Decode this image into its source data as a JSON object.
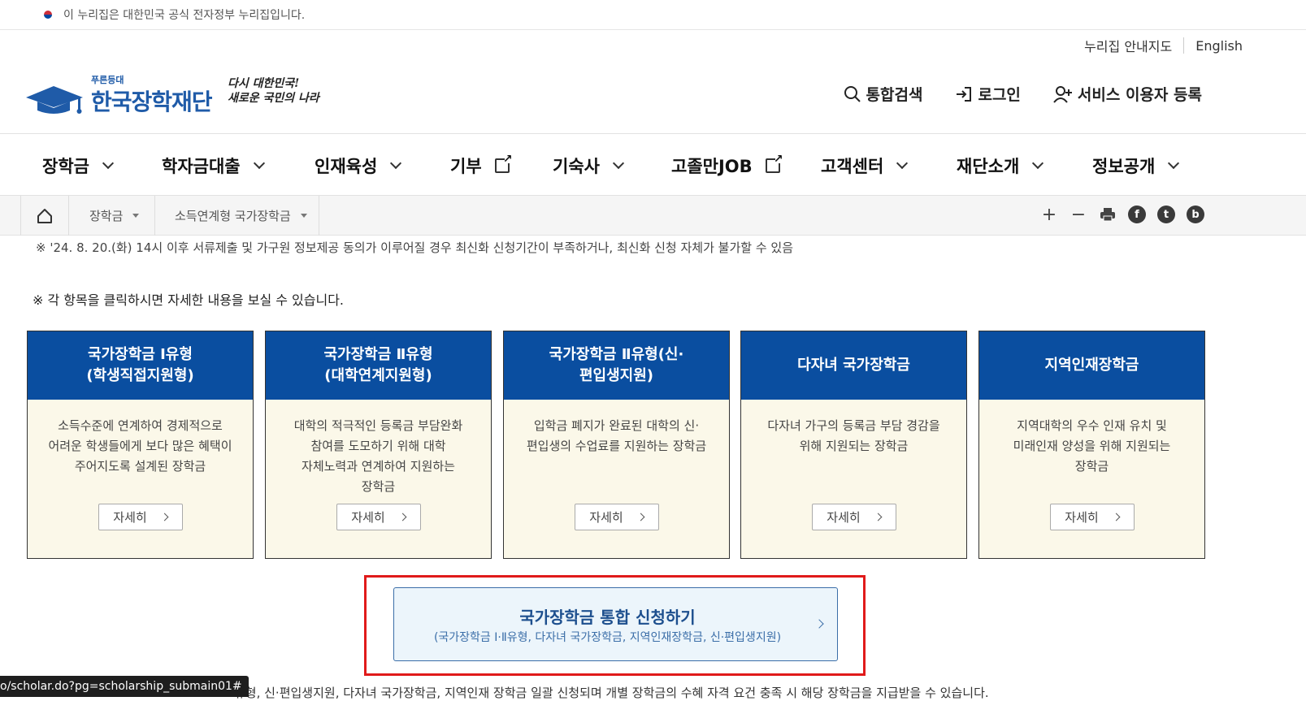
{
  "gov_bar": {
    "text": "이 누리집은 대한민국 공식 전자정부 누리집입니다."
  },
  "util": {
    "sitemap": "누리집 안내지도",
    "english": "English"
  },
  "logo": {
    "small": "푸른등대",
    "big": "한국장학재단",
    "slogan_line1": "다시 대한민국!",
    "slogan_line2": "새로운 국민의 나라"
  },
  "header_links": {
    "search": "통합검색",
    "login": "로그인",
    "register": "서비스 이용자 등록"
  },
  "gnb": {
    "items": [
      {
        "label": "장학금",
        "type": "dropdown"
      },
      {
        "label": "학자금대출",
        "type": "dropdown"
      },
      {
        "label": "인재육성",
        "type": "dropdown"
      },
      {
        "label": "기부",
        "type": "external"
      },
      {
        "label": "기숙사",
        "type": "dropdown"
      },
      {
        "label": "고졸만JOB",
        "type": "external"
      },
      {
        "label": "고객센터",
        "type": "dropdown"
      },
      {
        "label": "재단소개",
        "type": "dropdown"
      },
      {
        "label": "정보공개",
        "type": "dropdown"
      }
    ]
  },
  "breadcrumb": {
    "level1": "장학금",
    "level2": "소득연계형 국가장학금"
  },
  "notes": {
    "deadline": "※ '24. 8. 20.(화) 14시 이후 서류제출 및 가구원 정보제공 동의가 이루어질 경우 최신화 신청기간이 부족하거나, 최신화 신청 자체가 불가할 수 있음",
    "click_hint": "※ 각 항목을 클릭하시면 자세한 내용을 보실 수 있습니다."
  },
  "cards": [
    {
      "title1": "국가장학금 Ⅰ유형",
      "title2": "(학생직접지원형)",
      "desc": [
        "소득수준에 연계하여 경제적으로",
        "어려운 학생들에게 보다 많은 혜택이",
        "주어지도록 설계된 장학금"
      ],
      "more": "자세히"
    },
    {
      "title1": "국가장학금 Ⅱ유형",
      "title2": "(대학연계지원형)",
      "desc": [
        "대학의 적극적인 등록금 부담완화",
        "참여를 도모하기 위해 대학",
        "자체노력과 연계하여 지원하는",
        "장학금"
      ],
      "more": "자세히"
    },
    {
      "title1": "국가장학금 Ⅱ유형(신·",
      "title2": "편입생지원)",
      "desc": [
        "입학금 폐지가 완료된 대학의 신·",
        "편입생의 수업료를 지원하는 장학금"
      ],
      "more": "자세히"
    },
    {
      "title1": "다자녀 국가장학금",
      "title2": "",
      "desc": [
        "다자녀 가구의 등록금 부담 경감을",
        "위해 지원되는 장학금"
      ],
      "more": "자세히"
    },
    {
      "title1": "지역인재장학금",
      "title2": "",
      "desc": [
        "지역대학의 우수 인재 유치 및",
        "미래인재 양성을 위해 지원되는",
        "장학금"
      ],
      "more": "자세히"
    }
  ],
  "apply": {
    "title": "국가장학금 통합 신청하기",
    "sub": "(국가장학금 Ⅰ·Ⅱ유형, 다자녀 국가장학금, 지역인재장학금, 신·편입생지원)"
  },
  "bottom_text": "유형, 신·편입생지원, 다자녀 국가장학금, 지역인재 장학금 일괄 신청되며 개별 장학금의 수혜 자격 요건 충족 시 해당 장학금을 지급받을 수 있습니다.",
  "status_url": "o/scholar.do?pg=scholarship_submain01#",
  "colors": {
    "brand_blue": "#0a4ea0",
    "card_bg": "#fbf8e9",
    "highlight_red": "#e01a1a",
    "apply_bg": "#ecf5fb"
  }
}
